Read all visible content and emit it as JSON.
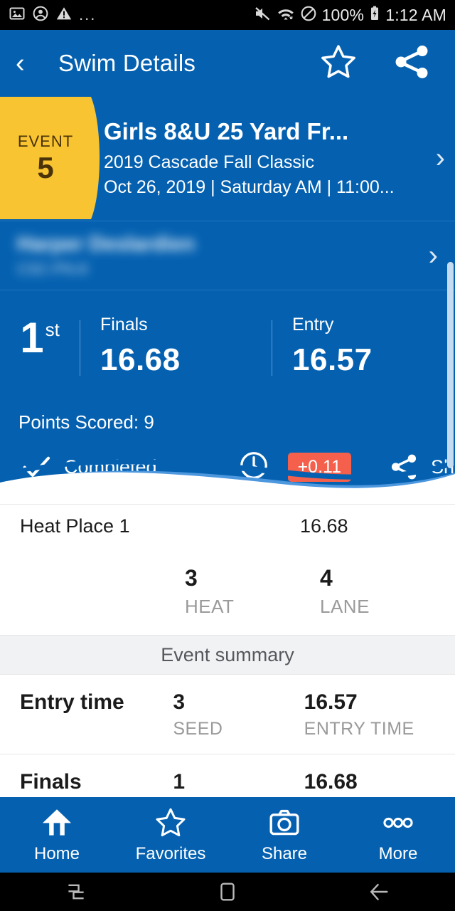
{
  "statusbar": {
    "left_icons": [
      "image-icon",
      "account-circle-icon",
      "warning-triangle-icon"
    ],
    "overflow": "...",
    "battery_percent": "100%",
    "time": "1:12 AM",
    "right_icons": [
      "mute-icon",
      "wifi-icon",
      "do-not-disturb-icon",
      "battery-charging-icon"
    ]
  },
  "appbar": {
    "back_label": "‹",
    "title": "Swim Details",
    "favorite_icon": "star-outline-icon",
    "share_icon": "share-icon"
  },
  "event_card": {
    "tab_label": "EVENT",
    "tab_number": "5",
    "title": "Girls 8&U 25 Yard Fr...",
    "meet": "2019 Cascade Fall Classic",
    "when": "Oct 26, 2019 | Saturday AM | 11:00...",
    "chevron": "›"
  },
  "swimmer_row": {
    "name": "Harper Deslardien",
    "subtitle": "CSC-PN-8",
    "chevron": "›",
    "redacted": true
  },
  "result": {
    "place_number": "1",
    "place_ordinal": "st",
    "finals_label": "Finals",
    "finals_time": "16.68",
    "entry_label": "Entry",
    "entry_time": "16.57",
    "points_scored": "Points Scored: 9",
    "status_label": "Completed",
    "status_icon": "check-icon",
    "clock_icon": "clock-icon",
    "delta_badge": "+0.11",
    "share_label": "Share",
    "share_icon": "share-icon"
  },
  "details": {
    "heat_place_label": "Heat Place 1",
    "heat_place_time": "16.68",
    "heat_number": "3",
    "heat_caption": "HEAT",
    "lane_number": "4",
    "lane_caption": "LANE"
  },
  "summary": {
    "section_title": "Event summary",
    "rows": [
      {
        "title": "Entry time",
        "col1_value": "3",
        "col1_caption": "SEED",
        "col2_value": "16.57",
        "col2_caption": "ENTRY TIME"
      },
      {
        "title": "Finals",
        "col1_value": "1",
        "col1_caption": "",
        "col2_value": "16.68",
        "col2_caption": ""
      }
    ]
  },
  "bottomnav": {
    "items": [
      {
        "label": "Home",
        "icon": "home-icon"
      },
      {
        "label": "Favorites",
        "icon": "star-outline-icon"
      },
      {
        "label": "Share",
        "icon": "camera-icon"
      },
      {
        "label": "More",
        "icon": "more-dots-icon"
      }
    ]
  },
  "sysnav": {
    "recents": "recents-icon",
    "home": "home-square-icon",
    "back": "back-arrow-icon"
  },
  "colors": {
    "primary_blue": "#0561B0",
    "wave_light_blue": "#4C97DE",
    "accent_gold": "#F8C431",
    "badge_red": "#F4604B",
    "section_gray": "#f1f2f4"
  }
}
